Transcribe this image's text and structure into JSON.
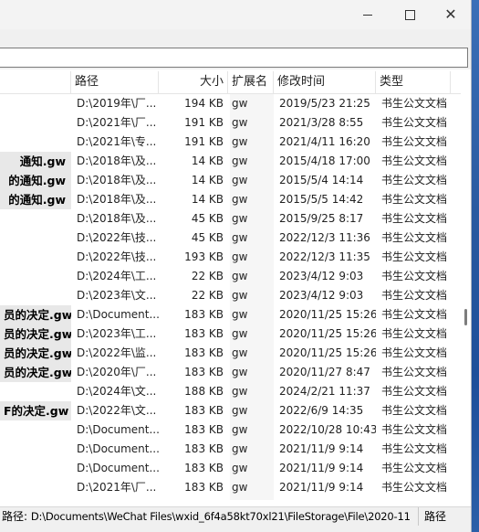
{
  "window": {
    "minimize_label": "—",
    "maximize_label": "☐",
    "close_label": "✕"
  },
  "columns": {
    "path": "路径",
    "size": "大小",
    "ext": "扩展名",
    "date": "修改时间",
    "type": "类型"
  },
  "rows": [
    {
      "name": "",
      "path": "D:\\2019年\\厂...",
      "size": "194 KB",
      "ext": "gw",
      "date": "2019/5/23 21:25",
      "type": "书生公文文档"
    },
    {
      "name": "",
      "path": "D:\\2021年\\厂...",
      "size": "191 KB",
      "ext": "gw",
      "date": "2021/3/28 8:55",
      "type": "书生公文文档"
    },
    {
      "name": "",
      "path": "D:\\2021年\\专...",
      "size": "191 KB",
      "ext": "gw",
      "date": "2021/4/11 16:20",
      "type": "书生公文文档"
    },
    {
      "name": "通知.gw",
      "path": "D:\\2018年\\及...",
      "size": "14 KB",
      "ext": "gw",
      "date": "2015/4/18 17:00",
      "type": "书生公文文档"
    },
    {
      "name": "的通知.gw",
      "path": "D:\\2018年\\及...",
      "size": "14 KB",
      "ext": "gw",
      "date": "2015/5/4 14:14",
      "type": "书生公文文档"
    },
    {
      "name": "的通知.gw",
      "path": "D:\\2018年\\及...",
      "size": "14 KB",
      "ext": "gw",
      "date": "2015/5/5 14:42",
      "type": "书生公文文档"
    },
    {
      "name": "",
      "path": "D:\\2018年\\及...",
      "size": "45 KB",
      "ext": "gw",
      "date": "2015/9/25 8:17",
      "type": "书生公文文档"
    },
    {
      "name": "",
      "path": "D:\\2022年\\技...",
      "size": "45 KB",
      "ext": "gw",
      "date": "2022/12/3 11:36",
      "type": "书生公文文档"
    },
    {
      "name": "",
      "path": "D:\\2022年\\技...",
      "size": "193 KB",
      "ext": "gw",
      "date": "2022/12/3 11:35",
      "type": "书生公文文档"
    },
    {
      "name": "",
      "path": "D:\\2024年\\工...",
      "size": "22 KB",
      "ext": "gw",
      "date": "2023/4/12 9:03",
      "type": "书生公文文档"
    },
    {
      "name": "",
      "path": "D:\\2023年\\文...",
      "size": "22 KB",
      "ext": "gw",
      "date": "2023/4/12 9:03",
      "type": "书生公文文档"
    },
    {
      "name": "员的决定.gw",
      "path": "D:\\Document...",
      "size": "183 KB",
      "ext": "gw",
      "date": "2020/11/25 15:26",
      "type": "书生公文文档"
    },
    {
      "name": "员的决定.gw",
      "path": "D:\\2023年\\工...",
      "size": "183 KB",
      "ext": "gw",
      "date": "2020/11/25 15:26",
      "type": "书生公文文档"
    },
    {
      "name": "员的决定.gw",
      "path": "D:\\2022年\\监...",
      "size": "183 KB",
      "ext": "gw",
      "date": "2020/11/25 15:26",
      "type": "书生公文文档"
    },
    {
      "name": "员的决定.gw",
      "path": "D:\\2020年\\厂...",
      "size": "183 KB",
      "ext": "gw",
      "date": "2020/11/27 8:47",
      "type": "书生公文文档"
    },
    {
      "name": "",
      "path": "D:\\2024年\\文...",
      "size": "188 KB",
      "ext": "gw",
      "date": "2024/2/21 11:37",
      "type": "书生公文文档"
    },
    {
      "name": "F的决定.gw",
      "path": "D:\\2022年\\文...",
      "size": "183 KB",
      "ext": "gw",
      "date": "2022/6/9 14:35",
      "type": "书生公文文档"
    },
    {
      "name": "",
      "path": "D:\\Document...",
      "size": "183 KB",
      "ext": "gw",
      "date": "2022/10/28 10:43",
      "type": "书生公文文档"
    },
    {
      "name": "",
      "path": "D:\\Document...",
      "size": "183 KB",
      "ext": "gw",
      "date": "2021/11/9 9:14",
      "type": "书生公文文档"
    },
    {
      "name": "",
      "path": "D:\\Document...",
      "size": "183 KB",
      "ext": "gw",
      "date": "2021/11/9 9:14",
      "type": "书生公文文档"
    },
    {
      "name": "",
      "path": "D:\\2021年\\厂...",
      "size": "183 KB",
      "ext": "gw",
      "date": "2021/11/9 9:14",
      "type": "书生公文文档"
    }
  ],
  "status": {
    "path_label": "路径: ",
    "path_value": "D:\\Documents\\WeChat Files\\wxid_6f4a58kt70xl21\\FileStorage\\File\\2020-11",
    "right_label": "路径"
  }
}
